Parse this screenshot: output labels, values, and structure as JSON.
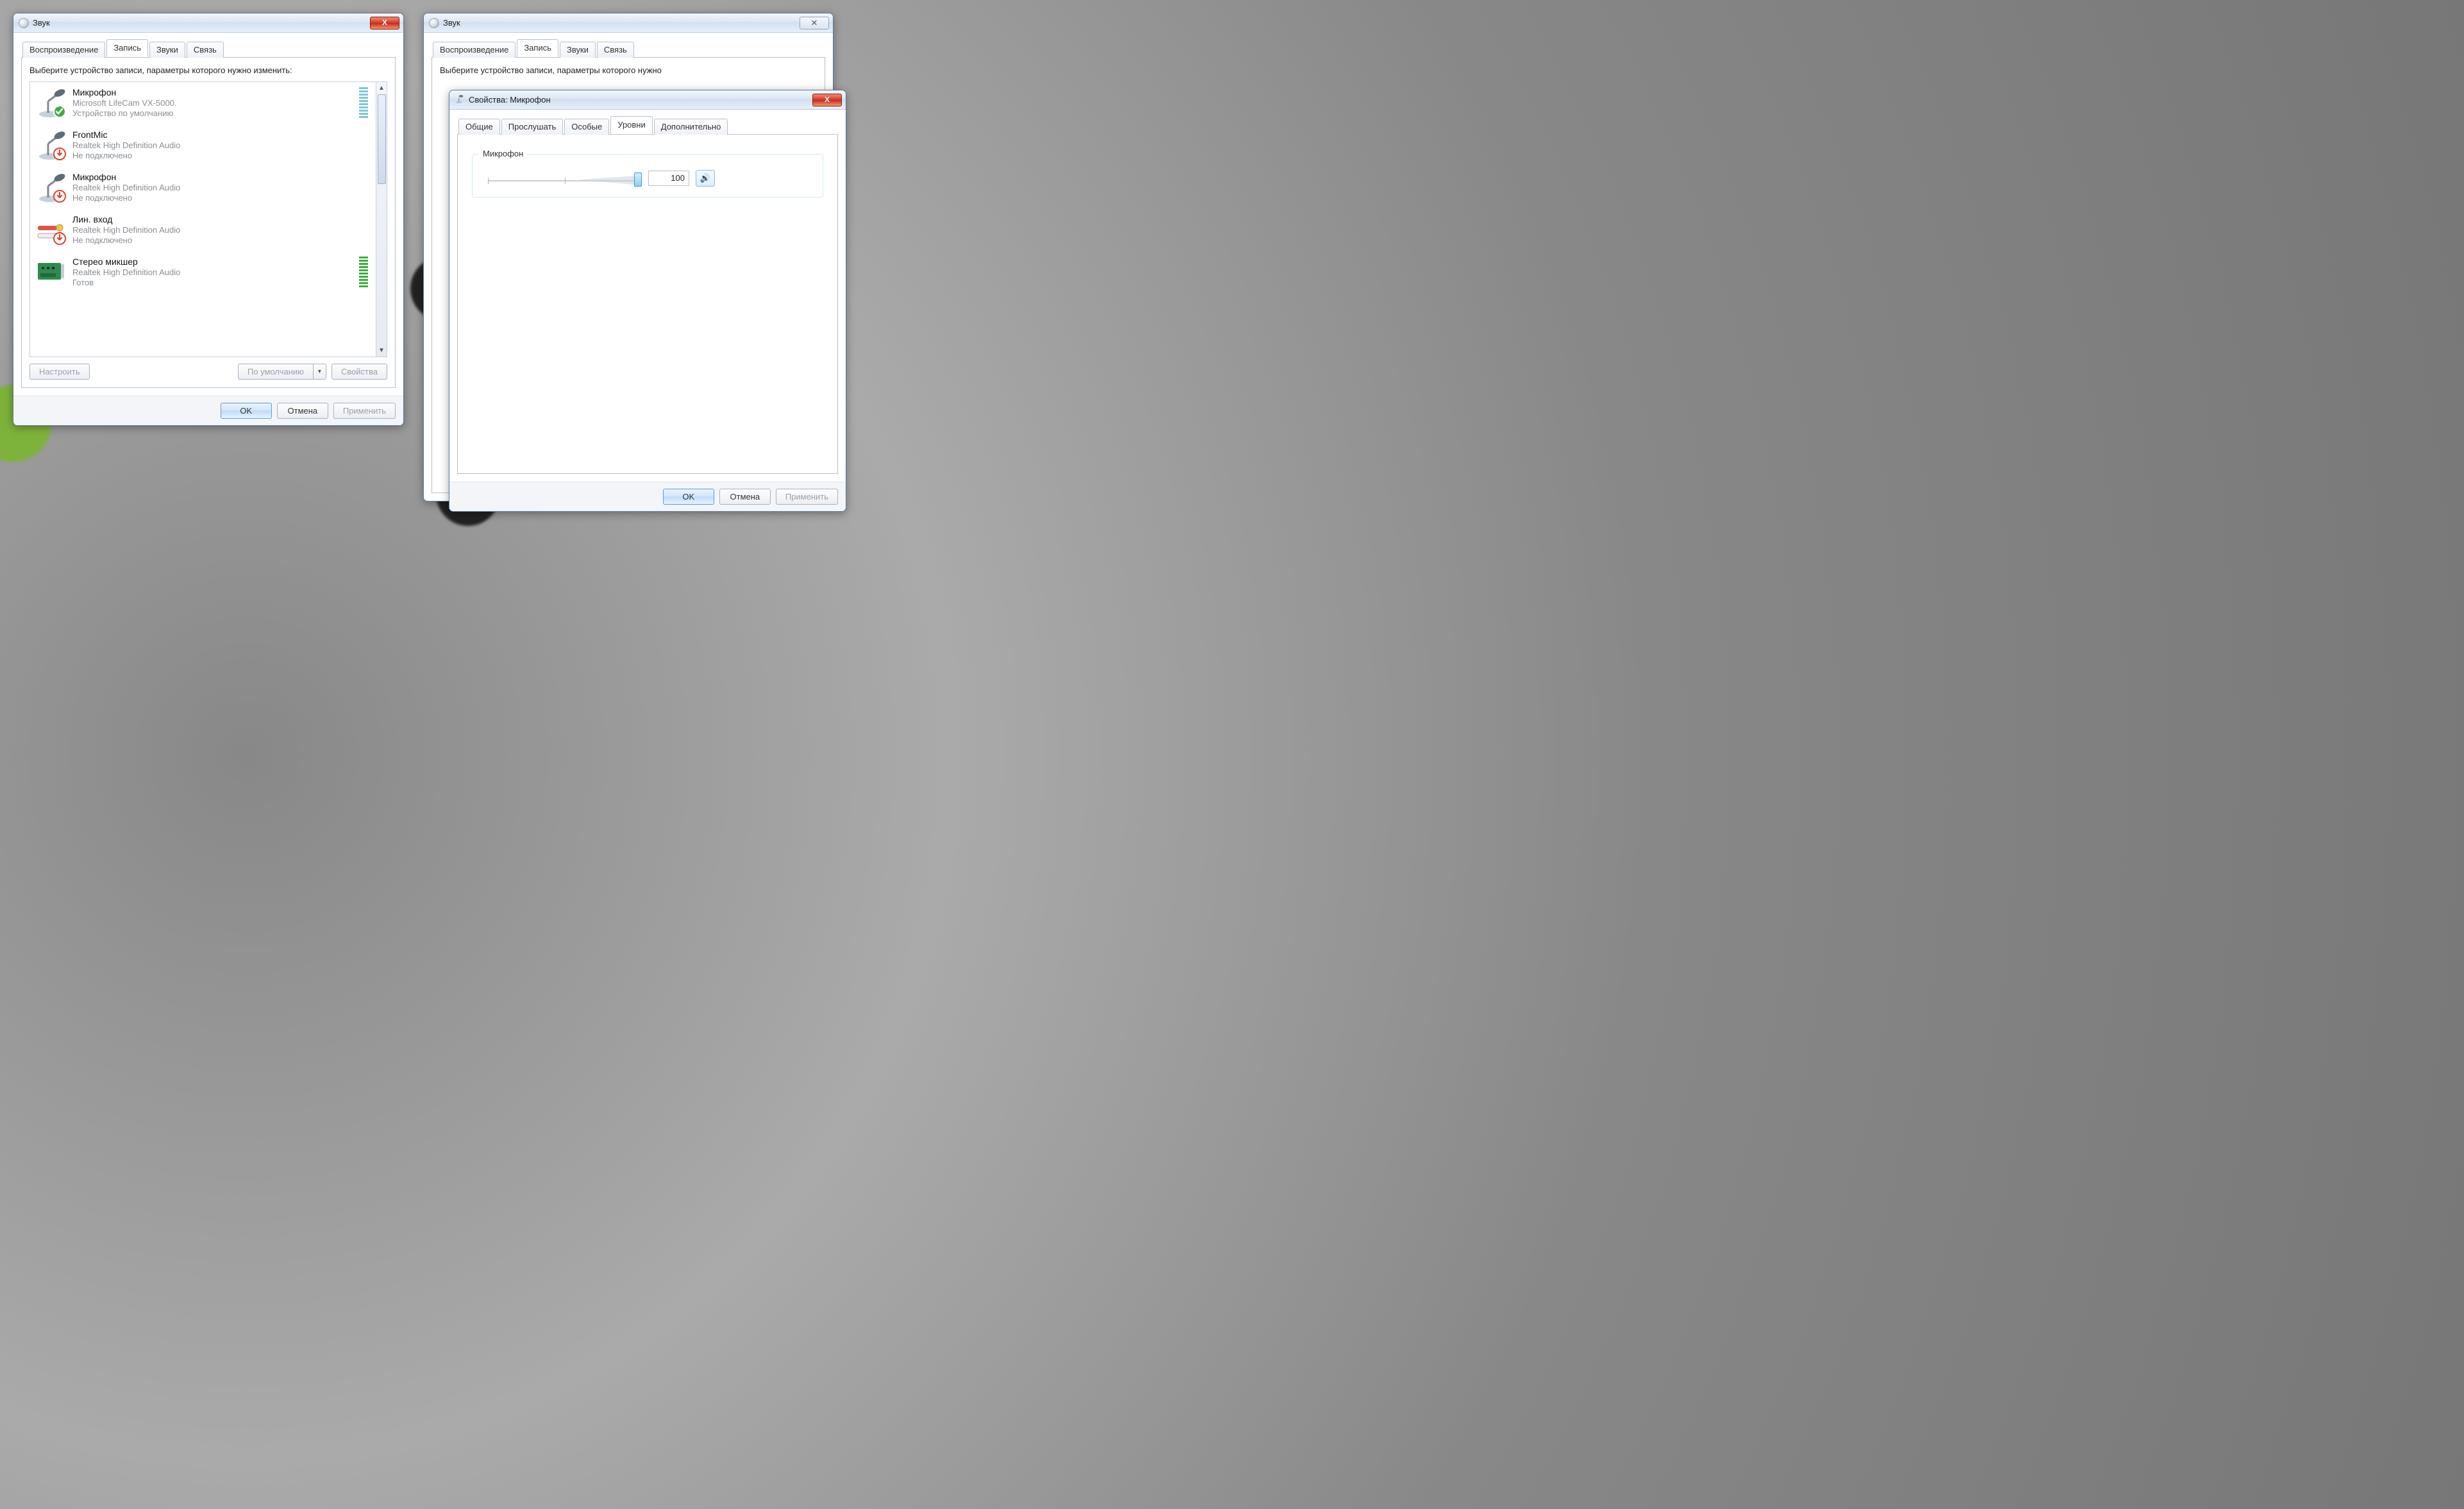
{
  "left_window": {
    "title": "Звук",
    "tabs": [
      "Воспроизведение",
      "Запись",
      "Звуки",
      "Связь"
    ],
    "active_tab_index": 1,
    "hint": "Выберите устройство записи, параметры которого нужно изменить:",
    "devices": [
      {
        "name": "Микрофон",
        "driver": "Microsoft LifeCam VX-5000.",
        "status": "Устройство по умолчанию",
        "icon": "mic",
        "badge": "default",
        "meter": "blue",
        "meter_level": 10
      },
      {
        "name": "FrontMic",
        "driver": "Realtek High Definition Audio",
        "status": "Не подключено",
        "icon": "mic",
        "badge": "unplugged",
        "meter": "none",
        "meter_level": 0
      },
      {
        "name": "Микрофон",
        "driver": "Realtek High Definition Audio",
        "status": "Не подключено",
        "icon": "mic",
        "badge": "unplugged",
        "meter": "none",
        "meter_level": 0
      },
      {
        "name": "Лин. вход",
        "driver": "Realtek High Definition Audio",
        "status": "Не подключено",
        "icon": "linein",
        "badge": "unplugged",
        "meter": "none",
        "meter_level": 0
      },
      {
        "name": "Стерео микшер",
        "driver": "Realtek High Definition Audio",
        "status": "Готов",
        "icon": "card",
        "badge": "none",
        "meter": "green",
        "meter_level": 10
      }
    ],
    "buttons": {
      "configure": "Настроить",
      "set_default": "По умолчанию",
      "properties": "Свойства"
    },
    "footer": {
      "ok": "OK",
      "cancel": "Отмена",
      "apply": "Применить"
    }
  },
  "right_back_window": {
    "title": "Звук",
    "tabs": [
      "Воспроизведение",
      "Запись",
      "Звуки",
      "Связь"
    ],
    "active_tab_index": 1,
    "hint_visible": "Выберите устройство записи, параметры которого нужно"
  },
  "right_front_window": {
    "title": "Свойства: Микрофон",
    "tabs": [
      "Общие",
      "Прослушать",
      "Особые",
      "Уровни",
      "Дополнительно"
    ],
    "active_tab_index": 3,
    "group_label": "Микрофон",
    "level_value": "100",
    "footer": {
      "ok": "OK",
      "cancel": "Отмена",
      "apply": "Применить"
    }
  },
  "icons": {
    "close": "X",
    "close_sym": "✕",
    "dropdown": "▾",
    "scroll_up": "▲",
    "scroll_down": "▼",
    "speaker": "🔊"
  }
}
